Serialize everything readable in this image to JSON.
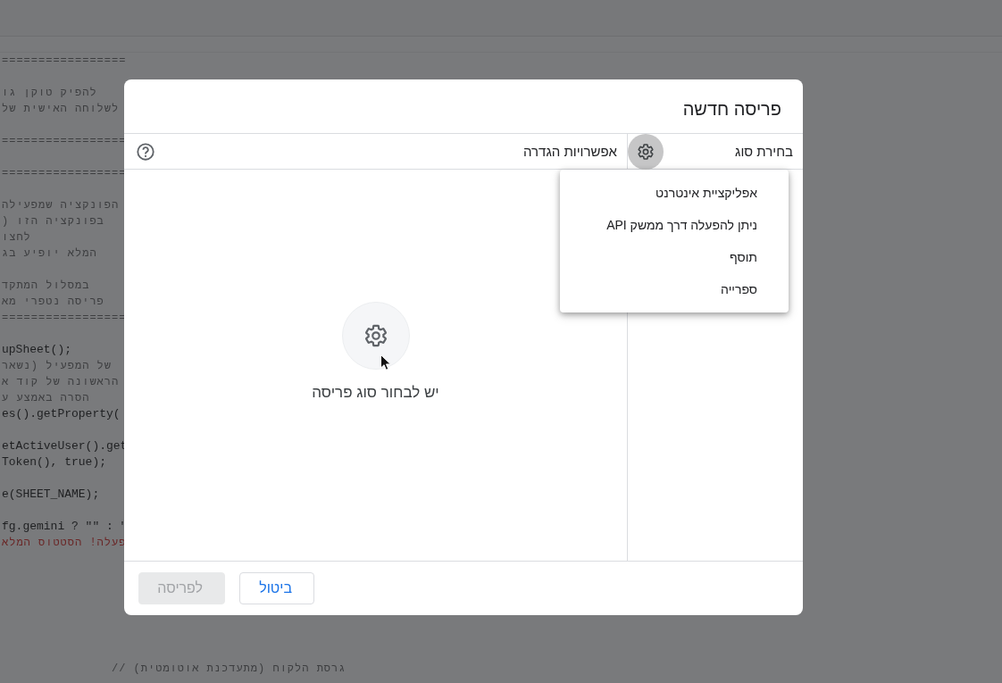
{
  "code_blocks": [
    [
      {
        "text": "=================",
        "kind": "comment"
      }
    ],
    [
      {
        "text": "להפיק טוקן גו",
        "kind": "comment"
      },
      {
        "text": "לשלוחה האישית של",
        "kind": "comment"
      }
    ],
    [
      {
        "text": "=================",
        "kind": "comment"
      }
    ],
    [
      {
        "text": "=================",
        "kind": "comment"
      }
    ],
    [
      {
        "text": "הפונקציה שמפעילה",
        "kind": "comment"
      },
      {
        "text": "בפונקציה הזו (",
        "kind": "comment"
      },
      {
        "text": "לחצו",
        "kind": "comment"
      },
      {
        "text": "המלא יופיע בג",
        "kind": "comment"
      }
    ],
    [
      {
        "text": "במסלול המתקד",
        "kind": "comment"
      },
      {
        "text": "פריסה נטפרי מא",
        "kind": "comment"
      },
      {
        "text": "=================",
        "kind": "comment"
      }
    ],
    [
      {
        "text": "upSheet();",
        "kind": "code"
      },
      {
        "text": "של המפעיל (נשאר",
        "kind": "comment"
      },
      {
        "text": "הראשונה של קוד א",
        "kind": "comment"
      },
      {
        "text": "הסרה באמצע ע",
        "kind": "comment"
      },
      {
        "text": "es().getProperty(",
        "kind": "code"
      }
    ],
    [
      {
        "text": "etActiveUser().get",
        "kind": "code"
      },
      {
        "text": "Token(), true);",
        "kind": "code"
      }
    ],
    [
      {
        "text": "e(SHEET_NAME);",
        "kind": "code"
      }
    ],
    [
      {
        "text": "fg.gemini ? \"\" : \"",
        "kind": "code"
      },
      {
        "text": "פעלה! הסטטוס המלא",
        "kind": "string"
      }
    ]
  ],
  "footer_comment": "גרסת הלקוח (מתעדכנת אוטומטית) //",
  "dialog": {
    "title": "פריסה חדשה",
    "type_column": {
      "label": "בחירת סוג"
    },
    "settings_column": {
      "label": "אפשרויות הגדרה",
      "empty_message": "יש לבחור סוג פריסה"
    },
    "type_menu": {
      "items": [
        {
          "label": "אפליקציית אינטרנט"
        },
        {
          "label": "ניתן להפעלה דרך ממשק API"
        },
        {
          "label": "תוסף"
        },
        {
          "label": "ספרייה"
        }
      ]
    },
    "buttons": [
      {
        "label": "ביטול",
        "kind": "secondary",
        "disabled": false
      },
      {
        "label": "לפריסה",
        "kind": "primary",
        "disabled": true
      }
    ]
  }
}
